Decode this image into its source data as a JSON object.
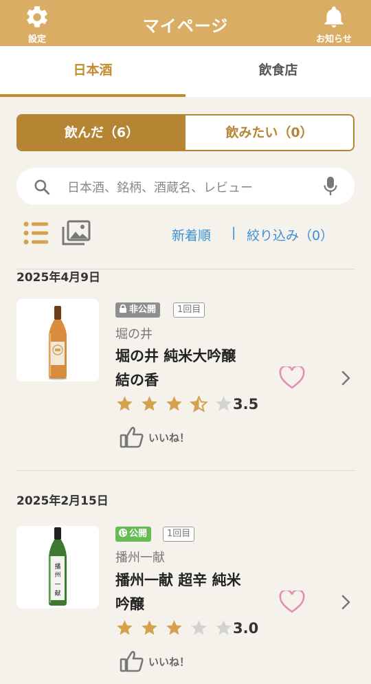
{
  "header": {
    "title": "マイページ",
    "settings_label": "設定",
    "notice_label": "お知らせ",
    "color": "#d9ad63"
  },
  "tabs": [
    {
      "label": "日本酒",
      "active": true
    },
    {
      "label": "飲食店",
      "active": false
    }
  ],
  "segment": {
    "drank": "飲んだ（6）",
    "want": "飲みたい（0）",
    "active": "drank"
  },
  "search": {
    "placeholder": "日本酒、銘柄、酒蔵名、レビュー"
  },
  "view": {
    "sort_label": "新着順",
    "separator": "|",
    "filter_label": "絞り込み（0）"
  },
  "entries": [
    {
      "date": "2025年4月9日",
      "visibility": "非公開",
      "visibility_icon": "lock-icon",
      "count": "1回目",
      "brewery": "堀の井",
      "name_line1": "堀の井 純米大吟醸",
      "name_line2": "結の香",
      "rating": "3.5",
      "rating_value": 3.5,
      "like_label": "いいね！"
    },
    {
      "date": "2025年2月15日",
      "visibility": "公開",
      "visibility_icon": "globe-icon",
      "count": "1回目",
      "brewery": "播州一献",
      "name_line1": "播州一献 超辛 純米",
      "name_line2": "吟醸",
      "rating": "3.0",
      "rating_value": 3.0,
      "like_label": "いいね！"
    }
  ]
}
